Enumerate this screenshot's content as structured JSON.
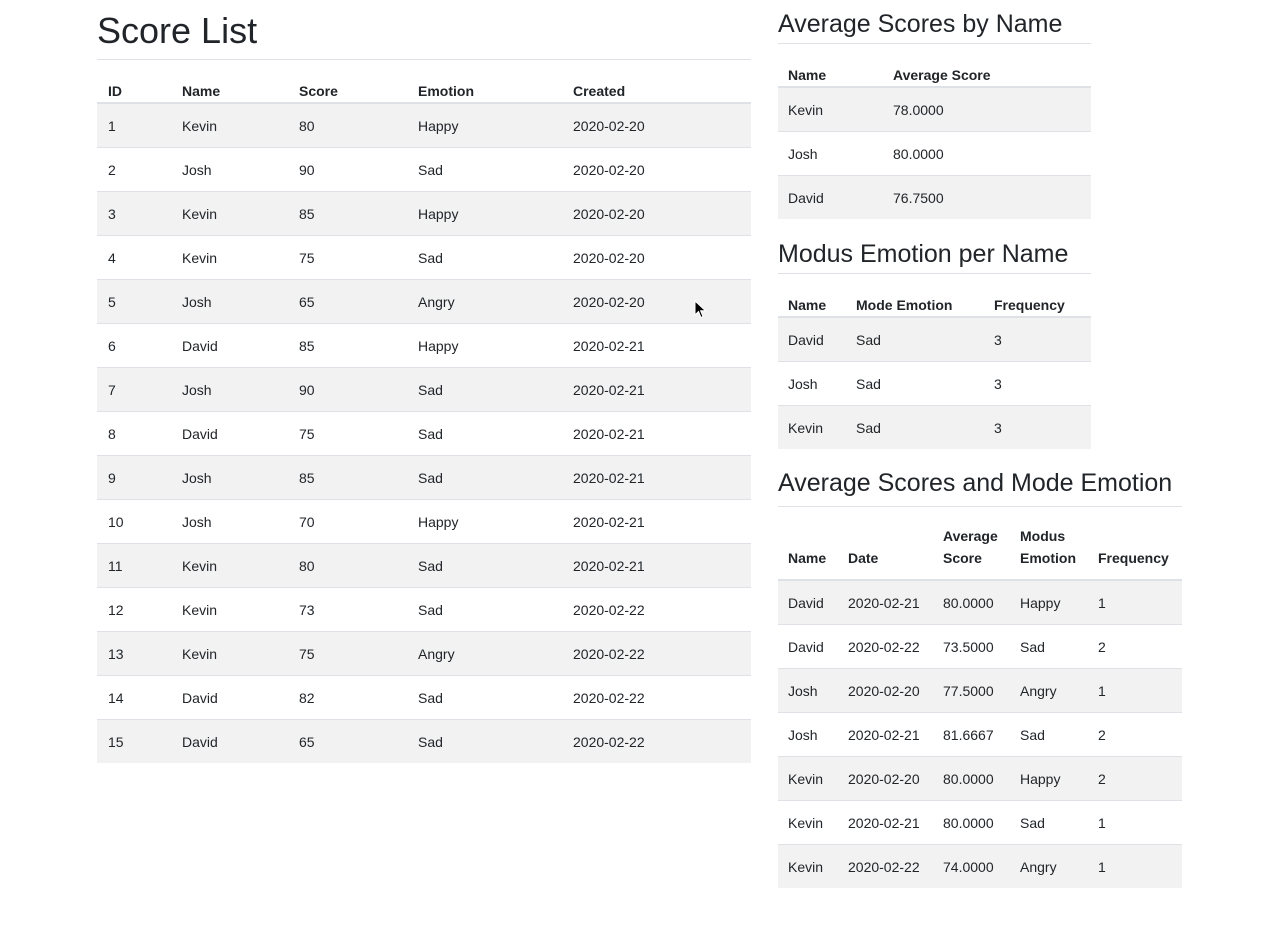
{
  "score_list": {
    "title": "Score List",
    "headers": [
      "ID",
      "Name",
      "Score",
      "Emotion",
      "Created"
    ],
    "rows": [
      [
        "1",
        "Kevin",
        "80",
        "Happy",
        "2020-02-20"
      ],
      [
        "2",
        "Josh",
        "90",
        "Sad",
        "2020-02-20"
      ],
      [
        "3",
        "Kevin",
        "85",
        "Happy",
        "2020-02-20"
      ],
      [
        "4",
        "Kevin",
        "75",
        "Sad",
        "2020-02-20"
      ],
      [
        "5",
        "Josh",
        "65",
        "Angry",
        "2020-02-20"
      ],
      [
        "6",
        "David",
        "85",
        "Happy",
        "2020-02-21"
      ],
      [
        "7",
        "Josh",
        "90",
        "Sad",
        "2020-02-21"
      ],
      [
        "8",
        "David",
        "75",
        "Sad",
        "2020-02-21"
      ],
      [
        "9",
        "Josh",
        "85",
        "Sad",
        "2020-02-21"
      ],
      [
        "10",
        "Josh",
        "70",
        "Happy",
        "2020-02-21"
      ],
      [
        "11",
        "Kevin",
        "80",
        "Sad",
        "2020-02-21"
      ],
      [
        "12",
        "Kevin",
        "73",
        "Sad",
        "2020-02-22"
      ],
      [
        "13",
        "Kevin",
        "75",
        "Angry",
        "2020-02-22"
      ],
      [
        "14",
        "David",
        "82",
        "Sad",
        "2020-02-22"
      ],
      [
        "15",
        "David",
        "65",
        "Sad",
        "2020-02-22"
      ]
    ]
  },
  "avg_by_name": {
    "title": "Average Scores by Name",
    "headers": [
      "Name",
      "Average Score"
    ],
    "rows": [
      [
        "Kevin",
        "78.0000"
      ],
      [
        "Josh",
        "80.0000"
      ],
      [
        "David",
        "76.7500"
      ]
    ]
  },
  "mode_by_name": {
    "title": "Modus Emotion per Name",
    "headers": [
      "Name",
      "Mode Emotion",
      "Frequency"
    ],
    "rows": [
      [
        "David",
        "Sad",
        "3"
      ],
      [
        "Josh",
        "Sad",
        "3"
      ],
      [
        "Kevin",
        "Sad",
        "3"
      ]
    ]
  },
  "avg_and_mode": {
    "title": "Average Scores and Mode Emotion",
    "headers": [
      "Name",
      "Date",
      "Average Score",
      "Modus Emotion",
      "Frequency"
    ],
    "rows": [
      [
        "David",
        "2020-02-21",
        "80.0000",
        "Happy",
        "1"
      ],
      [
        "David",
        "2020-02-22",
        "73.5000",
        "Sad",
        "2"
      ],
      [
        "Josh",
        "2020-02-20",
        "77.5000",
        "Angry",
        "1"
      ],
      [
        "Josh",
        "2020-02-21",
        "81.6667",
        "Sad",
        "2"
      ],
      [
        "Kevin",
        "2020-02-20",
        "80.0000",
        "Happy",
        "2"
      ],
      [
        "Kevin",
        "2020-02-21",
        "80.0000",
        "Sad",
        "1"
      ],
      [
        "Kevin",
        "2020-02-22",
        "74.0000",
        "Angry",
        "1"
      ]
    ]
  },
  "colors": {
    "stripe": "#f2f2f2",
    "border": "#dee2e6",
    "text": "#212529"
  },
  "cursor_icon": "mouse-pointer-icon"
}
